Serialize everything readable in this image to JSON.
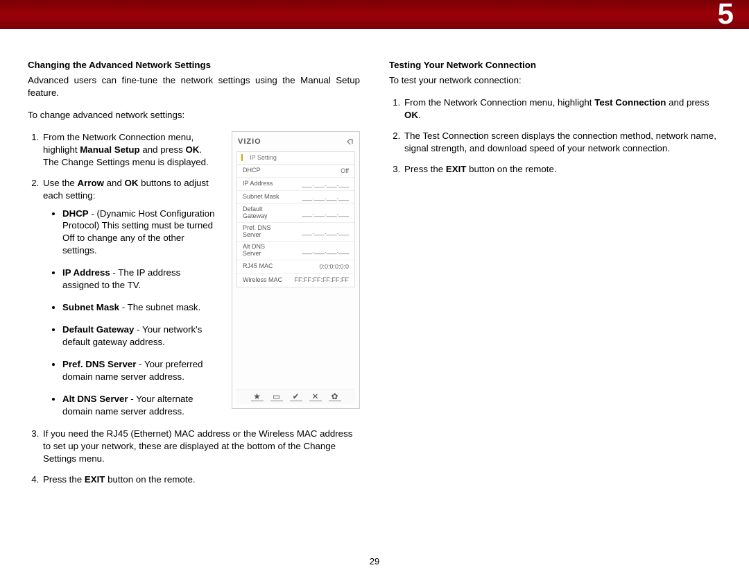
{
  "chapter": "5",
  "page_number": "29",
  "left": {
    "title": "Changing the Advanced Network Settings",
    "intro": "Advanced users can fine-tune the network settings using the Manual Setup feature.",
    "lead": "To change advanced network settings:",
    "step1_a": "From the Network Connection menu, highlight ",
    "step1_b": "Manual Setup",
    "step1_c": " and press ",
    "step1_d": "OK",
    "step1_e": ". The Change Settings menu is displayed.",
    "step2_a": "Use the ",
    "step2_b": "Arrow",
    "step2_c": " and ",
    "step2_d": "OK",
    "step2_e": " buttons to adjust each setting:",
    "bul1_b": "DHCP",
    "bul1_t": " - (Dynamic Host Configuration Protocol) This setting must be turned Off to change any of the other settings.",
    "bul2_b": "IP Address",
    "bul2_t": " - The IP address assigned to the TV.",
    "bul3_b": "Subnet Mask",
    "bul3_t": " - The subnet mask.",
    "bul4_b": "Default Gateway",
    "bul4_t": " - Your network's default gateway address.",
    "bul5_b": "Pref. DNS Server",
    "bul5_t": " - Your preferred domain name server address.",
    "bul6_b": "Alt DNS Server",
    "bul6_t": " - Your alternate domain name server address.",
    "step3": "If you need the RJ45 (Ethernet) MAC address or the Wireless MAC address to set up your network, these are displayed at the bottom of the Change Settings menu.",
    "step4_a": "Press the ",
    "step4_b": "EXIT",
    "step4_c": " button on the remote."
  },
  "right": {
    "title": "Testing Your Network Connection",
    "intro": "To test your network connection:",
    "step1_a": "From the Network Connection menu, highlight ",
    "step1_b": "Test Connection",
    "step1_c": " and press ",
    "step1_d": "OK",
    "step1_e": ".",
    "step2": "The Test Connection screen displays the connection method, network name, signal strength, and download speed of your network connection.",
    "step3_a": "Press the ",
    "step3_b": "EXIT",
    "step3_c": " button on the remote."
  },
  "tv": {
    "brand": "VIZIO",
    "menu_title": "IP Setting",
    "blank_ip": "___.___.___.___",
    "rows": {
      "dhcp_l": "DHCP",
      "dhcp_v": "Off",
      "ip_l": "IP Address",
      "subnet_l": "Subnet Mask",
      "gateway_l": "Default\nGateway",
      "pref_l": "Pref. DNS\nServer",
      "alt_l": "Alt DNS\nServer",
      "rj45_l": "RJ45 MAC",
      "rj45_v": "0:0:0:0:0:0",
      "wmac_l": "Wireless MAC",
      "wmac_v": "FF:FF:FF:FF:FF:FF"
    },
    "footer": {
      "star": "★",
      "pip": "▭",
      "v": "✔",
      "x": "✕",
      "gear": "✿"
    }
  }
}
